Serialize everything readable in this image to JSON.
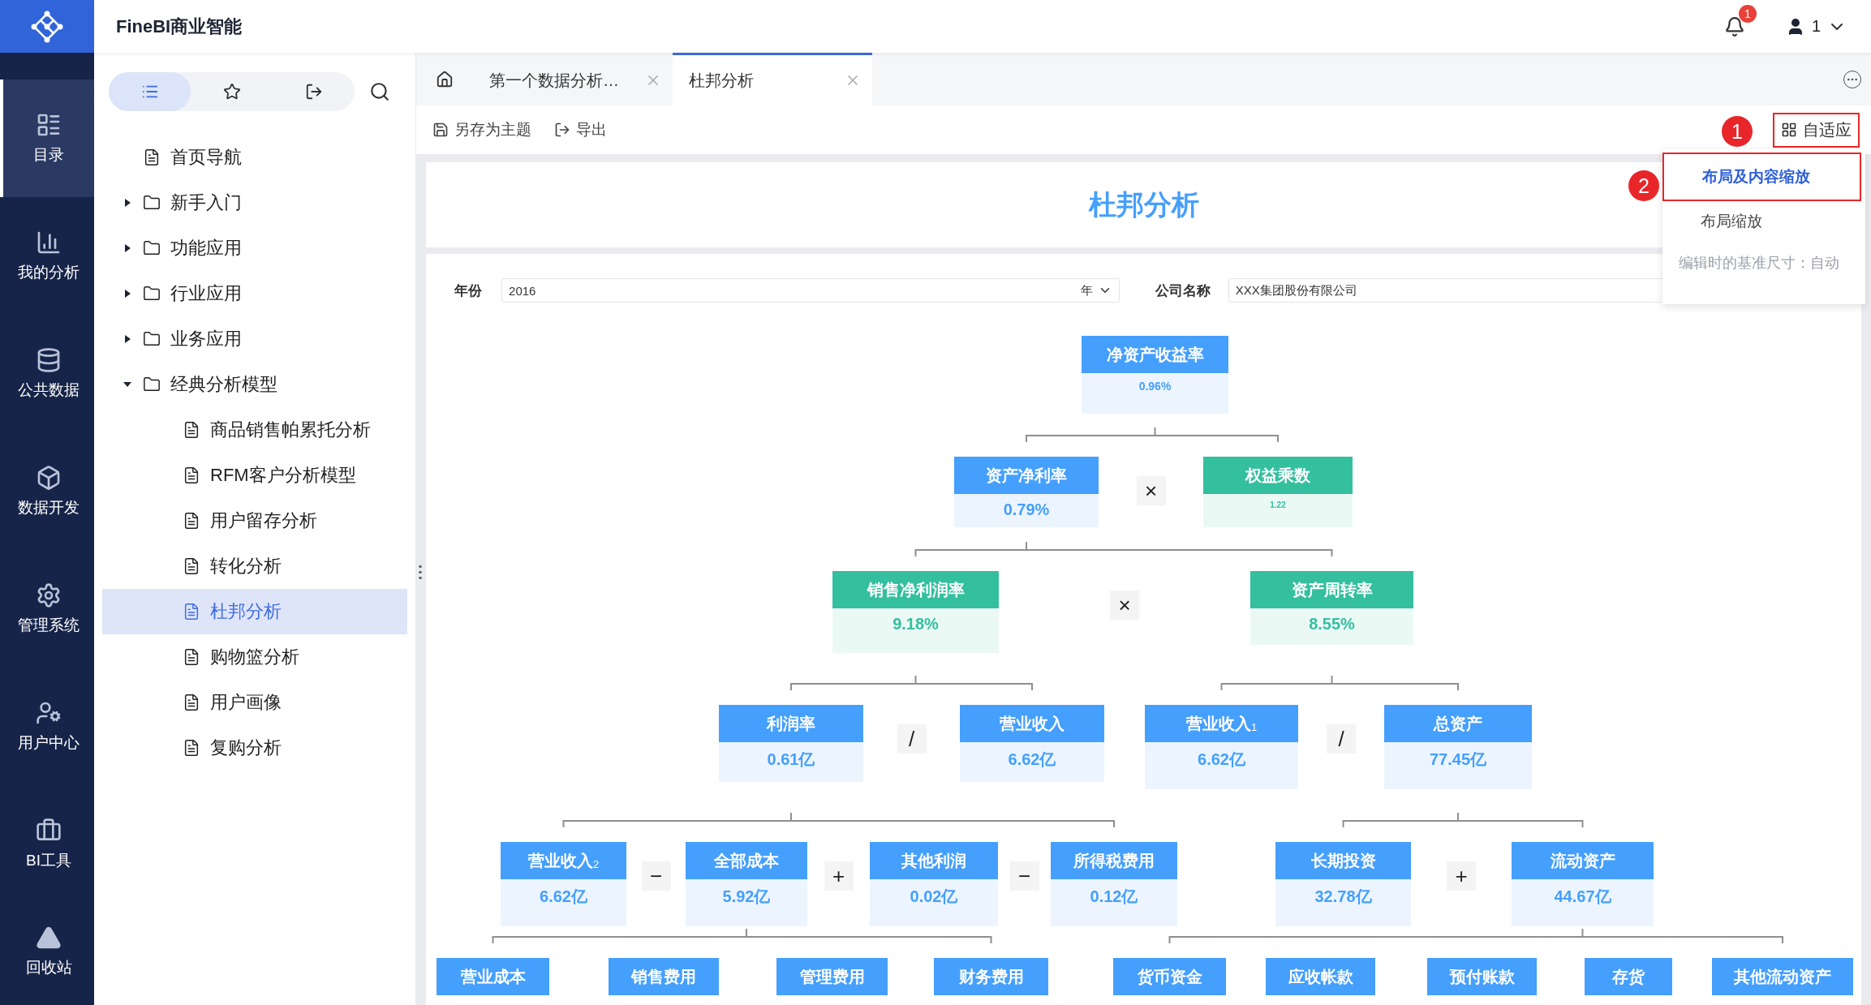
{
  "app": {
    "brand": "FineBI商业智能",
    "notification_count": "1",
    "user": "1"
  },
  "nav": [
    {
      "kind": "catalog",
      "label": "目录",
      "selected": true
    },
    {
      "kind": "analysis",
      "label": "我的分析",
      "selected": false
    },
    {
      "kind": "data",
      "label": "公共数据",
      "selected": false
    },
    {
      "kind": "dev",
      "label": "数据开发",
      "selected": false
    },
    {
      "kind": "admin",
      "label": "管理系统",
      "selected": false
    },
    {
      "kind": "user",
      "label": "用户中心",
      "selected": false
    },
    {
      "kind": "tools",
      "label": "BI工具",
      "selected": false
    },
    {
      "kind": "recycle",
      "label": "回收站",
      "selected": false
    }
  ],
  "catalog": {
    "view_tabs": [
      {
        "kind": "list",
        "selected": true
      },
      {
        "kind": "favorites",
        "selected": false
      },
      {
        "kind": "export",
        "selected": false
      }
    ],
    "tree": [
      {
        "kind": "file",
        "label": "首页导航",
        "selected": false
      },
      {
        "kind": "folder",
        "label": "新手入门",
        "selected": false,
        "expanded": false
      },
      {
        "kind": "folder",
        "label": "功能应用",
        "selected": false,
        "expanded": false
      },
      {
        "kind": "folder",
        "label": "行业应用",
        "selected": false,
        "expanded": false
      },
      {
        "kind": "folder",
        "label": "业务应用",
        "selected": false,
        "expanded": false
      },
      {
        "kind": "folder",
        "label": "经典分析模型",
        "selected": false,
        "expanded": true,
        "children": [
          {
            "kind": "file",
            "label": "商品销售帕累托分析",
            "selected": false
          },
          {
            "kind": "file",
            "label": "RFM客户分析模型",
            "selected": false
          },
          {
            "kind": "file",
            "label": "用户留存分析",
            "selected": false
          },
          {
            "kind": "file",
            "label": "转化分析",
            "selected": false
          },
          {
            "kind": "file",
            "label": "杜邦分析",
            "selected": true
          },
          {
            "kind": "file",
            "label": "购物篮分析",
            "selected": false
          },
          {
            "kind": "file",
            "label": "用户画像",
            "selected": false
          },
          {
            "kind": "file",
            "label": "复购分析",
            "selected": false
          }
        ]
      }
    ]
  },
  "tabs": [
    {
      "label": "第一个数据分析…",
      "selected": false
    },
    {
      "label": "杜邦分析",
      "selected": true
    }
  ],
  "toolbar": {
    "actions": [
      {
        "kind": "save",
        "label": "另存为主题"
      },
      {
        "kind": "export",
        "label": "导出"
      }
    ],
    "fit_button": "自适应"
  },
  "fit_menu": {
    "items": [
      {
        "label": "布局及内容缩放",
        "selected": true
      },
      {
        "label": "布局缩放",
        "selected": false
      }
    ],
    "note": "编辑时的基准尺寸：自动"
  },
  "annotations": [
    {
      "label": "1"
    },
    {
      "label": "2"
    }
  ],
  "report": {
    "title": "杜邦分析",
    "filters": [
      {
        "label": "年份",
        "value": "2016",
        "unit": "年"
      },
      {
        "label": "公司名称",
        "value": "XXX集团股份有限公司"
      }
    ],
    "tree": {
      "title": "净资产收益率",
      "value": "0.96%",
      "color": "#459ffd",
      "operators": [
        "×"
      ],
      "children": [
        {
          "title": "资产净利率",
          "value": "0.79%",
          "color": "#459ffd",
          "operators": [
            "×"
          ],
          "children": [
            {
              "title": "销售净利润率",
              "value": "9.18%",
              "color": "#34bf9f",
              "operators": [
                "/"
              ],
              "children": [
                {
                  "title": "利润率",
                  "value": "0.61亿",
                  "color": "#459ffd",
                  "operators": [
                    "−",
                    "+",
                    "−"
                  ],
                  "children": [
                    {
                      "title": "营业收入$_{2}$",
                      "value": "6.62亿",
                      "color": "#459ffd"
                    },
                    {
                      "title": "全部成本",
                      "value": "5.92亿",
                      "color": "#459ffd",
                      "children": [
                        {
                          "title": "营业成本",
                          "color": "#459ffd"
                        },
                        {
                          "title": "销售费用",
                          "color": "#459ffd"
                        },
                        {
                          "title": "管理费用",
                          "color": "#459ffd"
                        },
                        {
                          "title": "财务费用",
                          "color": "#459ffd"
                        }
                      ]
                    },
                    {
                      "title": "其他利润",
                      "value": "0.02亿",
                      "color": "#459ffd"
                    },
                    {
                      "title": "所得税费用",
                      "value": "0.12亿",
                      "color": "#459ffd"
                    }
                  ]
                },
                {
                  "title": "营业收入",
                  "value": "6.62亿",
                  "color": "#459ffd"
                }
              ]
            },
            {
              "title": "资产周转率",
              "value": "8.55%",
              "color": "#34bf9f",
              "operators": [
                "/"
              ],
              "children": [
                {
                  "title": "营业收入$_{1}$",
                  "value": "6.62亿",
                  "color": "#459ffd"
                },
                {
                  "title": "总资产",
                  "value": "77.45亿",
                  "color": "#459ffd",
                  "operators": [
                    "+"
                  ],
                  "children": [
                    {
                      "title": "长期投资",
                      "value": "32.78亿",
                      "color": "#459ffd"
                    },
                    {
                      "title": "流动资产",
                      "value": "44.67亿",
                      "color": "#459ffd",
                      "children": [
                        {
                          "title": "货币资金",
                          "color": "#459ffd"
                        },
                        {
                          "title": "应收帐款",
                          "color": "#459ffd"
                        },
                        {
                          "title": "预付账款",
                          "color": "#459ffd"
                        },
                        {
                          "title": "存货",
                          "color": "#459ffd"
                        },
                        {
                          "title": "其他流动资产",
                          "color": "#459ffd"
                        }
                      ]
                    }
                  ]
                }
              ]
            }
          ]
        },
        {
          "title": "权益乘数",
          "value": "1.22",
          "color": "#34bf9f"
        }
      ]
    }
  }
}
